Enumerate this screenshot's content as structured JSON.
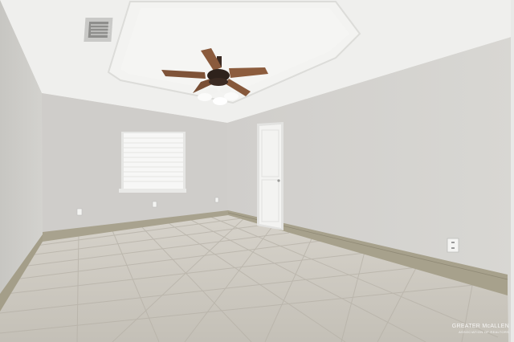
{
  "scene": {
    "watermark_text": "GREATER McALLEN",
    "watermark_sub": "ASSOCIATION OF REALTORS",
    "colors": {
      "ceiling": "#eeeeec",
      "wall_left": "#d2d1cd",
      "wall_back": "#cfcdc9",
      "wall_right": "#d4d2ce",
      "floor": "#c9c5bd",
      "baseboard": "#a39d88",
      "door": "#f1f1ef",
      "fan_blade": "#8a5a3c"
    }
  }
}
